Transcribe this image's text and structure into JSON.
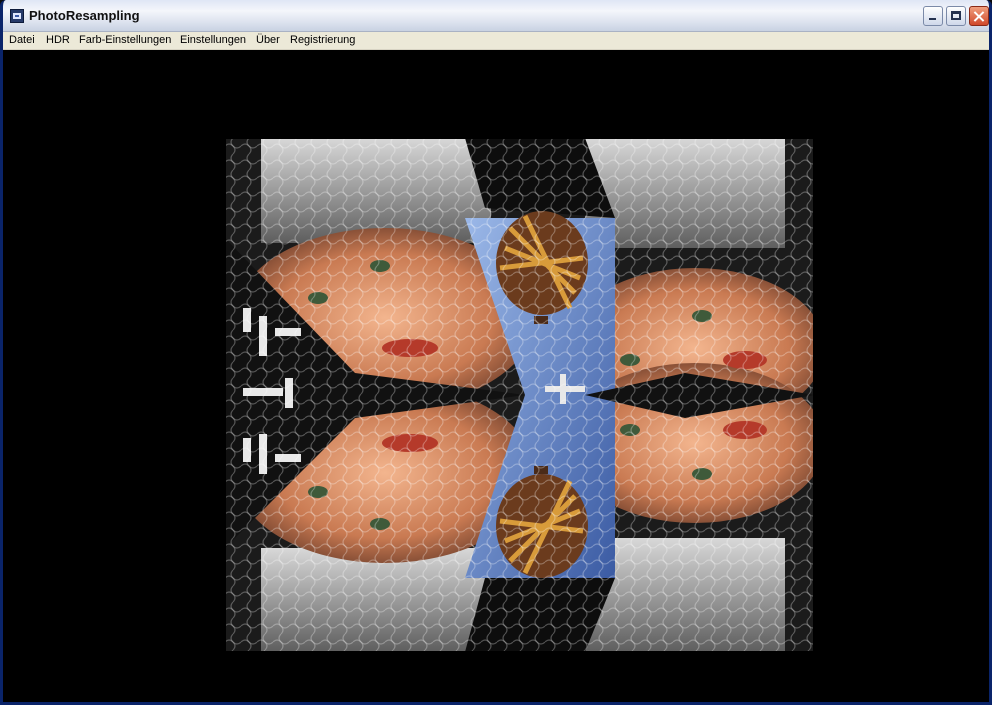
{
  "window": {
    "title": "PhotoResampling",
    "controls": [
      "minimize",
      "maximize",
      "close"
    ]
  },
  "menu": {
    "items": [
      "Datei",
      "HDR",
      "Farb-Einstellungen",
      "Einstellungen",
      "Über",
      "Registrierung"
    ]
  },
  "canvas": {
    "background": "#000000",
    "image_content": "kaleidoscope-mirrored-photo"
  },
  "icons": {
    "app": "app-icon",
    "minimize": "minimize-icon",
    "maximize": "maximize-icon",
    "close": "close-icon"
  }
}
